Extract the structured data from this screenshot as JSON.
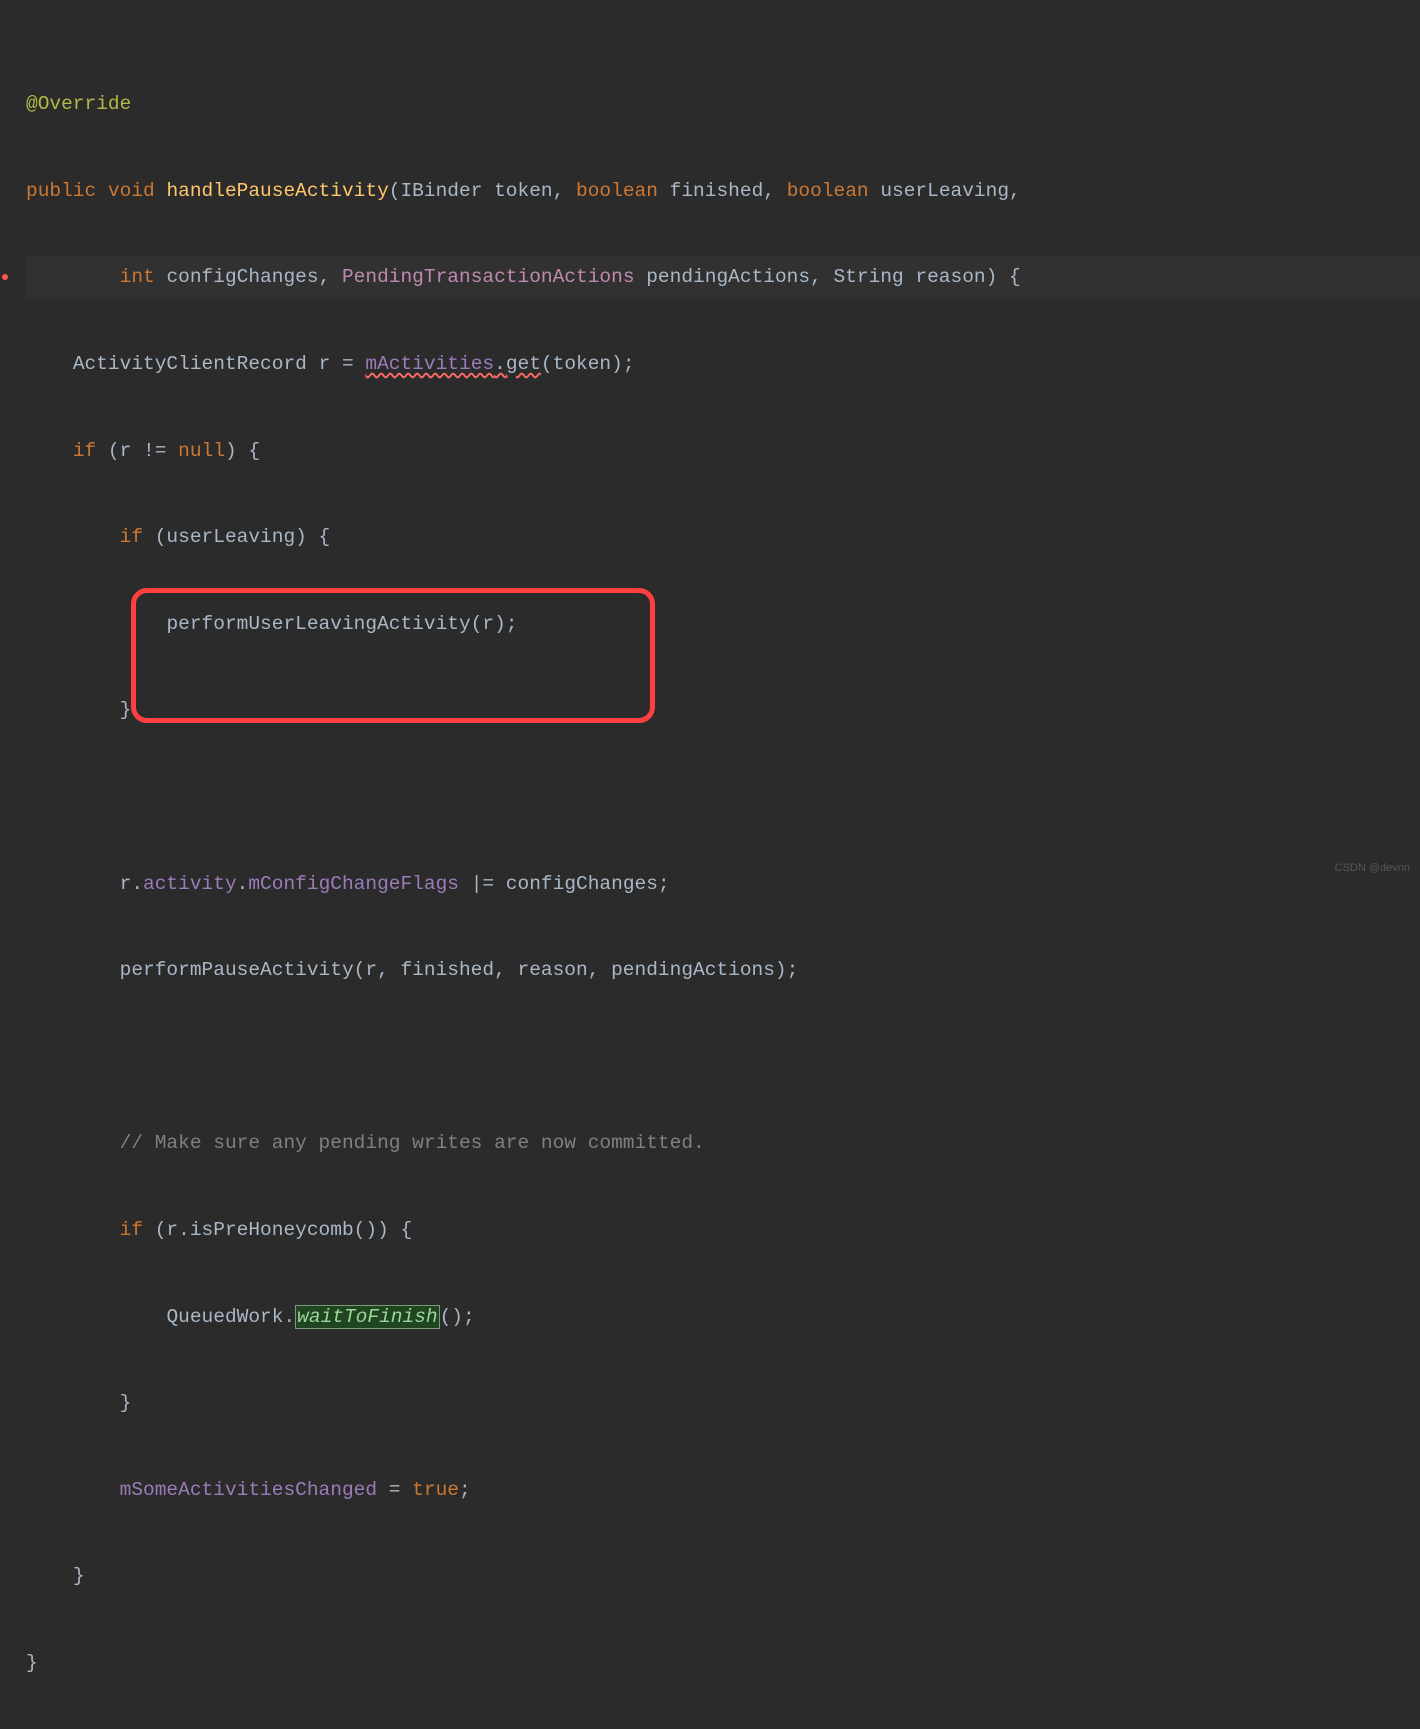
{
  "code": {
    "annotation": "@Override",
    "method_sig": {
      "modifier1": "public",
      "modifier2": "void",
      "name": "handlePauseActivity",
      "p1_type": "IBinder",
      "p1_name": "token",
      "p2_type": "boolean",
      "p2_name": "finished",
      "p3_type": "boolean",
      "p3_name": "userLeaving",
      "p4_type": "int",
      "p4_name": "configChanges",
      "p5_type": "PendingTransactionActions",
      "p5_name": "pendingActions",
      "p6_type": "String",
      "p6_name": "reason"
    },
    "body": {
      "l1_type": "ActivityClientRecord",
      "l1_var": "r",
      "l1_field": "mActivities",
      "l1_method": "get",
      "l1_arg": "token",
      "if1": "if",
      "if1_cond": "(r != ",
      "if1_null": "null",
      "if1_close": ") {",
      "if2": "if",
      "if2_cond": "(userLeaving) {",
      "call1": "performUserLeavingActivity(r);",
      "brace1": "}",
      "l2_pre": "r.",
      "l2_field1": "activity",
      "l2_dot": ".",
      "l2_field2": "mConfigChangeFlags",
      "l2_op": " |= configChanges;",
      "call2": "performPauseActivity(r, finished, reason, pendingActions);",
      "comment": "// Make sure any pending writes are now committed.",
      "if3": "if",
      "if3_cond": "(r.isPreHoneycomb()) {",
      "call3_pre": "QueuedWork.",
      "call3_hi": "waitToFinish",
      "call3_post": "();",
      "brace2": "}",
      "l3_field": "mSomeActivitiesChanged",
      "l3_op": " = ",
      "l3_val": "true",
      "l3_semi": ";",
      "brace3": "}",
      "brace4": "}"
    }
  },
  "watermark": "CSDN @devnn"
}
